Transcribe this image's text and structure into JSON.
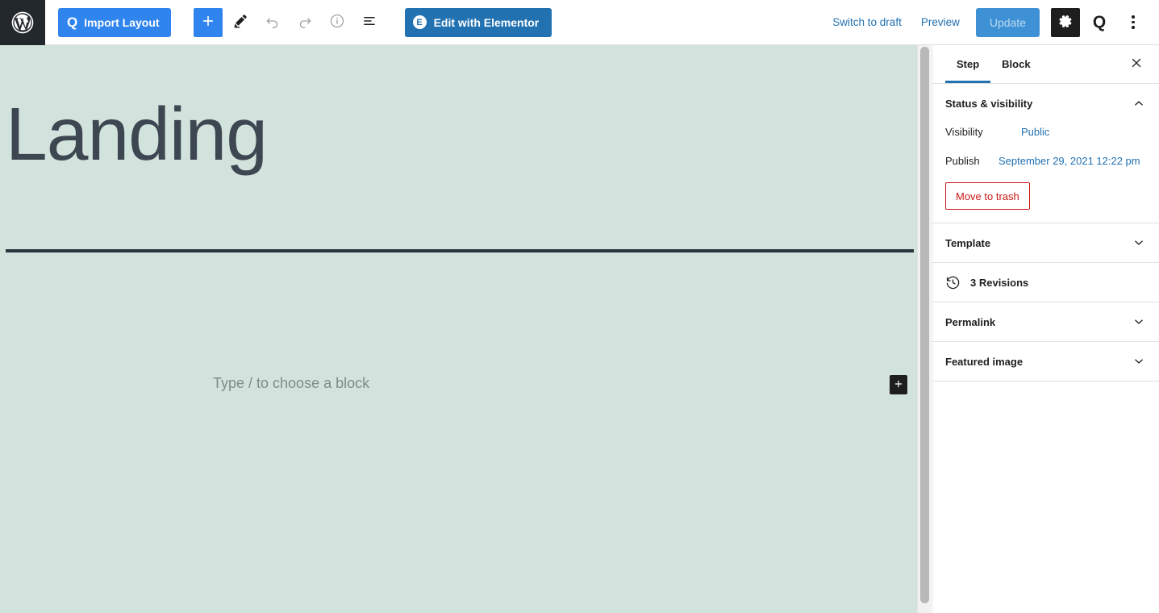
{
  "toolbar": {
    "wp_logo_name": "wordpress-logo",
    "import_layout_label": "Import Layout",
    "import_layout_icon": "q-logo-icon",
    "add_block_icon": "plus-icon",
    "edit_tool_icon": "pencil-icon",
    "undo_icon": "undo-arrow-icon",
    "redo_icon": "redo-arrow-icon",
    "details_icon": "info-circle-icon",
    "list_view_icon": "list-view-icon",
    "elementor_label": "Edit with Elementor",
    "elementor_icon": "elementor-logo-icon",
    "switch_to_draft_label": "Switch to draft",
    "preview_label": "Preview",
    "update_label": "Update",
    "settings_icon": "gear-icon",
    "quadlayers_icon": "q-logo-icon",
    "options_icon": "kebab-menu-icon"
  },
  "editor": {
    "post_title": "Landing",
    "block_placeholder": "Type / to choose a block",
    "inserter_icon": "plus-icon",
    "canvas_background": "#d2e2dc",
    "title_color": "#3d4751",
    "separator_color": "#28333b"
  },
  "sidebar": {
    "tabs": [
      {
        "label": "Step",
        "active": true
      },
      {
        "label": "Block",
        "active": false
      }
    ],
    "close_icon": "close-x-icon",
    "status_panel": {
      "title": "Status & visibility",
      "chevron_icon": "chevron-up-icon",
      "visibility_label": "Visibility",
      "visibility_value": "Public",
      "publish_label": "Publish",
      "publish_value": "September 29, 2021 12:22 pm",
      "trash_label": "Move to trash"
    },
    "template_panel": {
      "title": "Template",
      "chevron_icon": "chevron-down-icon"
    },
    "revisions_panel": {
      "icon": "revisions-clock-icon",
      "label": "3 Revisions"
    },
    "permalink_panel": {
      "title": "Permalink",
      "chevron_icon": "chevron-down-icon"
    },
    "featured_image_panel": {
      "title": "Featured image",
      "chevron_icon": "chevron-down-icon"
    }
  },
  "colors": {
    "accent_blue": "#2271b1",
    "bright_blue": "#2f84ee",
    "danger_red": "#cc1818",
    "dark": "#1e1e1e"
  }
}
